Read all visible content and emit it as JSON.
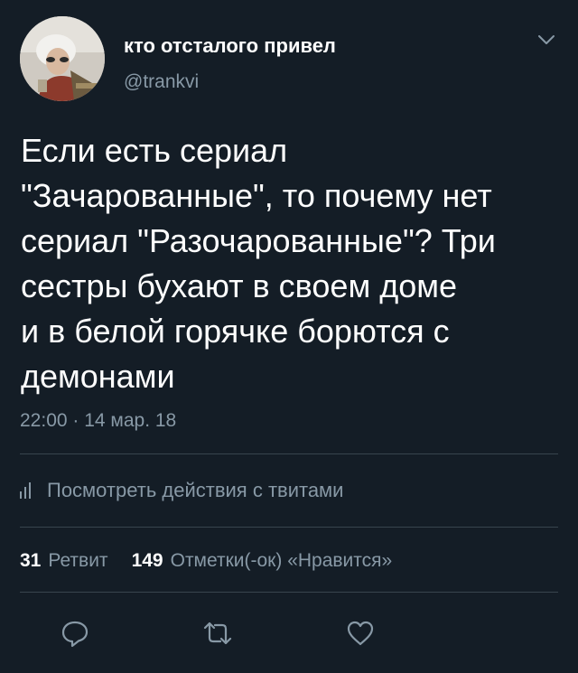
{
  "user": {
    "display_name": "кто отсталого привел",
    "handle": "@trankvi",
    "avatar_icon": "profile-photo"
  },
  "tweet": {
    "text_lines": [
      "Если есть сериал",
      "\"Зачарованные\", то почему нет",
      "сериал \"Разочарованные\"? Три",
      "сестры бухают в своем доме",
      "и в белой горячке борются с",
      "демонами"
    ],
    "timestamp": "22:00 · 14 мар. 18"
  },
  "analytics": {
    "icon": "bar-chart-icon",
    "label": "Посмотреть действия с твитами"
  },
  "stats": {
    "retweets_count": "31",
    "retweets_label": "Ретвит",
    "likes_count": "149",
    "likes_label": "Отметки(-ок) «Нравится»"
  },
  "actions": {
    "reply_icon": "reply-icon",
    "retweet_icon": "retweet-icon",
    "like_icon": "heart-icon"
  },
  "colors": {
    "background": "#141d26",
    "primary_text": "#ffffff",
    "secondary_text": "#8899a6",
    "divider": "#38444d"
  }
}
